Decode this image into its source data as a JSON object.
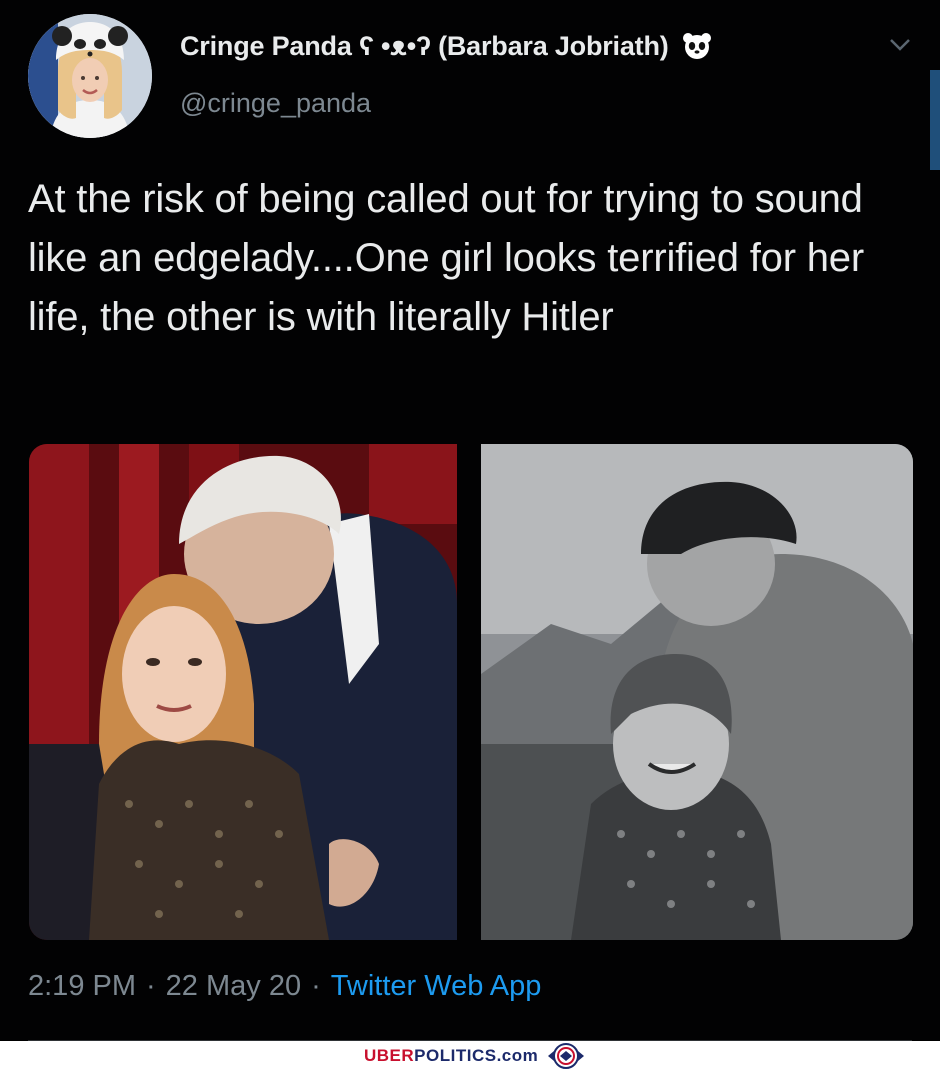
{
  "tweet": {
    "display_name": "Cringe Panda ʕ •ᴥ•ʔ (Barbara Jobriath)",
    "handle": "@cringe_panda",
    "text": "At the risk of being called out for trying to sound like an edgelady....One girl looks terrified for her life, the other is with literally Hitler",
    "time": "2:19 PM",
    "date": "22 May 20",
    "source": "Twitter Web App",
    "separator": "·"
  },
  "icons": {
    "verified_badge": "panda-face-icon",
    "menu": "chevron-down-icon"
  },
  "colors": {
    "background": "#020203",
    "text": "#e9ebec",
    "secondary": "#7d8891",
    "link": "#1d9bf0"
  },
  "watermark": {
    "part1": "UBER",
    "part2": "POLITICS.com"
  }
}
